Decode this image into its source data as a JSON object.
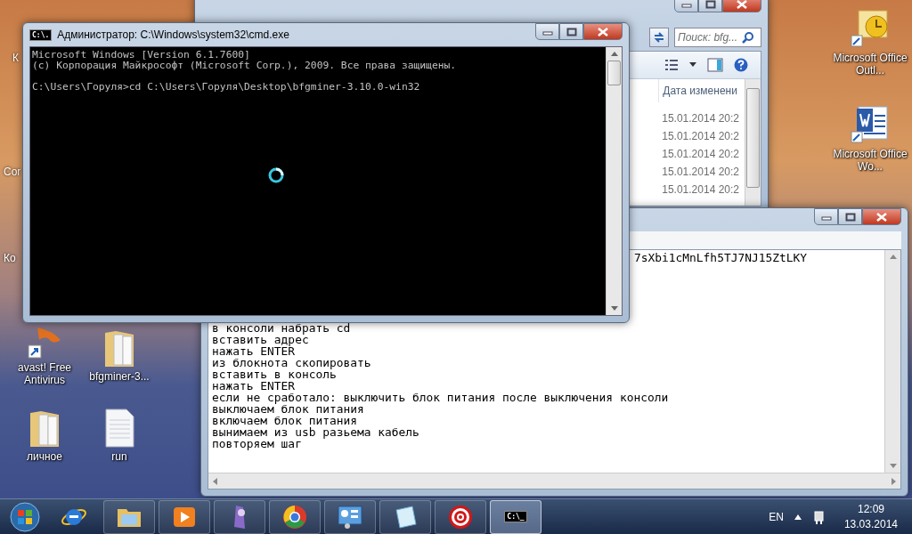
{
  "desktop": {
    "partial_labels": [
      "К",
      "Cor",
      "Ко"
    ],
    "icons": [
      {
        "label": "avast! Free Antivirus",
        "kind": "shortcut"
      },
      {
        "label": "bfgminer-3...",
        "kind": "folder"
      },
      {
        "label": "личное",
        "kind": "folder"
      },
      {
        "label": "run",
        "kind": "document"
      },
      {
        "label": "Microsoft Office Outl...",
        "kind": "outlook"
      },
      {
        "label": "Microsoft Office Wo...",
        "kind": "word"
      }
    ]
  },
  "explorer_window": {
    "search": {
      "placeholder": "Поиск: bfg..."
    },
    "column": "Дата изменени",
    "rows": [
      "15.01.2014 20:2",
      "15.01.2014 20:2",
      "15.01.2014 20:2",
      "15.01.2014 20:2",
      "15.01.2014 20:2"
    ]
  },
  "notepad_window": {
    "lines": [
      "7sXbi1cMnLfh5TJ7NJ15ZtLKY",
      "в консоли набрать cd",
      "вставить адрес",
      "нажать ENTER",
      "из блокнота скопировать",
      "вставить в консоль",
      "нажать ENTER",
      "если не сработало: выключить блок питания после выключения консоли",
      "выключаем блок питания",
      "включаем блок питания",
      "вынимаем из usb разьема кабель",
      "повторяем шаг"
    ]
  },
  "cmd_window": {
    "title": "Администратор: C:\\Windows\\system32\\cmd.exe",
    "icon_text": "C:\\.",
    "blocks": [
      [
        "Microsoft Windows [Version 6.1.7600]",
        "(c) Корпорация Майкрософт (Microsoft Corp.), 2009. Все права защищены."
      ],
      [
        "C:\\Users\\Горуля>cd C:\\Users\\Горуля\\Desktop\\bfgminer-3.10.0-win32"
      ]
    ],
    "busy": true
  },
  "taskbar": {
    "items": [
      {
        "kind": "ie",
        "selected": false
      },
      {
        "kind": "explorer",
        "selected": false
      },
      {
        "kind": "media",
        "selected": false
      },
      {
        "kind": "app",
        "selected": false
      },
      {
        "kind": "chrome",
        "selected": false
      },
      {
        "kind": "gadgets",
        "selected": false
      },
      {
        "kind": "notepad",
        "selected": false
      },
      {
        "kind": "target",
        "selected": false
      },
      {
        "kind": "cmd",
        "selected": true,
        "icon_text": "C:\\_"
      }
    ],
    "language": "EN",
    "time": "12:09",
    "date": "13.03.2014"
  }
}
